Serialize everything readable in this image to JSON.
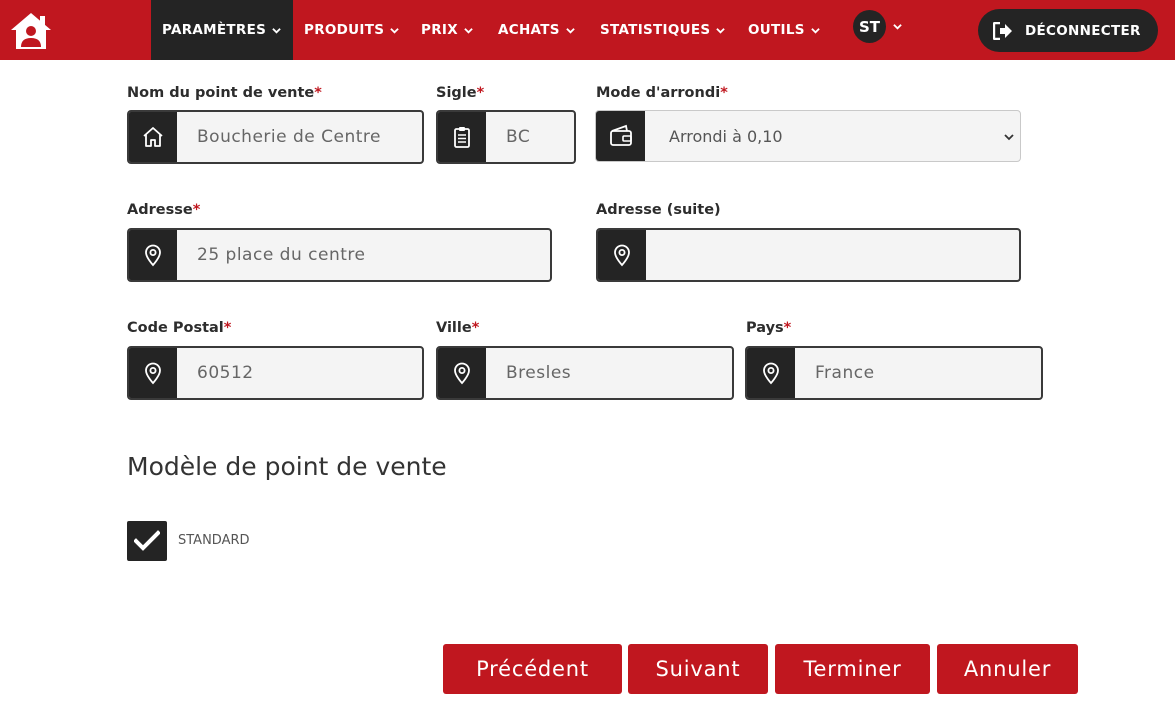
{
  "colors": {
    "brand": "#c0171f",
    "dark": "#242424",
    "field_bg": "#f4f4f4"
  },
  "nav": {
    "home_icon": "home-user-icon",
    "items": [
      {
        "label": "PARAMÈTRES",
        "active": true
      },
      {
        "label": "PRODUITS"
      },
      {
        "label": "PRIX"
      },
      {
        "label": "ACHATS"
      },
      {
        "label": "STATISTIQUES"
      },
      {
        "label": "OUTILS"
      }
    ],
    "avatar": "ST",
    "logout_label": "DÉCONNECTER"
  },
  "form": {
    "nom": {
      "label": "Nom du point de vente",
      "required": "*",
      "value": "Boucherie de Centre",
      "icon": "home-icon"
    },
    "sigle": {
      "label": "Sigle",
      "required": "*",
      "value": "BC",
      "icon": "clipboard-icon"
    },
    "arrondi": {
      "label": "Mode d'arrondi",
      "required": "*",
      "value": "Arrondi à 0,10",
      "icon": "wallet-icon"
    },
    "adresse": {
      "label": "Adresse",
      "required": "*",
      "value": "25 place du centre",
      "icon": "map-pin-icon"
    },
    "adresse_suite": {
      "label": "Adresse (suite)",
      "value": "",
      "icon": "map-pin-icon"
    },
    "code_postal": {
      "label": "Code Postal",
      "required": "*",
      "value": "60512",
      "icon": "map-pin-icon"
    },
    "ville": {
      "label": "Ville",
      "required": "*",
      "value": "Bresles",
      "icon": "map-pin-icon"
    },
    "pays": {
      "label": "Pays",
      "required": "*",
      "value": "France",
      "icon": "map-pin-icon"
    }
  },
  "model": {
    "title": "Modèle de point de vente",
    "option_label": "STANDARD",
    "checked": true
  },
  "buttons": {
    "previous": "Précédent",
    "next": "Suivant",
    "finish": "Terminer",
    "cancel": "Annuler"
  }
}
